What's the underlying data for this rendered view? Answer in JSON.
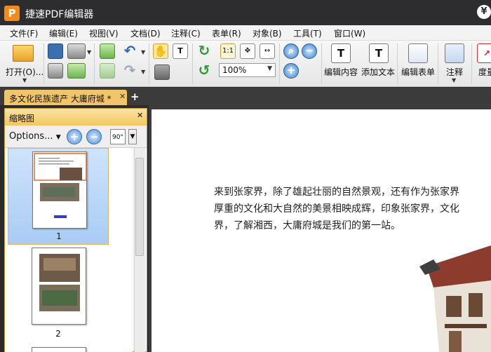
{
  "app": {
    "title": "捷速PDF编辑器",
    "logo_letter": "P",
    "currency_symbol": "¥"
  },
  "menu": [
    "文件(F)",
    "编辑(E)",
    "视图(V)",
    "文档(D)",
    "注释(C)",
    "表单(R)",
    "对象(B)",
    "工具(T)",
    "窗口(W)"
  ],
  "toolbar": {
    "open_label": "打开(O)...",
    "zoom_value": "100%",
    "edit_content_label": "编辑内容",
    "add_text_label": "添加文本",
    "edit_form_label": "编辑表单",
    "annotation_label": "注释",
    "measure_label": "度量",
    "actual_size_label": "1:1",
    "text_icon_letter": "T"
  },
  "tabs": {
    "document_tab": "多文化民族遗产 大庸府城 *"
  },
  "thumbnail_panel": {
    "title": "缩略图",
    "options_label": "Options...",
    "rotate_label": "90°",
    "pages": [
      "1",
      "2"
    ]
  },
  "document": {
    "lines": [
      "来到张家界，除了雄起壮丽的自然景观，还有作为张家界",
      "厚重的文化和大自然的美景相映成辉，印象张家界，文化",
      "界，了解湘西，大庸府城是我们的第一站。"
    ]
  }
}
